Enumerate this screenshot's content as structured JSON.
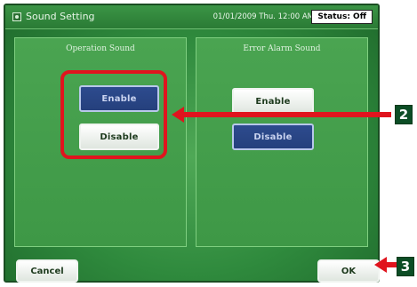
{
  "header": {
    "title": "Sound Setting",
    "datetime": "01/01/2009 Thu. 12:00 AM",
    "status": "Status: Off"
  },
  "panels": {
    "operation": {
      "label": "Operation Sound",
      "enable": "Enable",
      "disable": "Disable",
      "selected": "Enable"
    },
    "error": {
      "label": "Error Alarm Sound",
      "enable": "Enable",
      "disable": "Disable",
      "selected": "Disable"
    }
  },
  "footer": {
    "cancel": "Cancel",
    "ok": "OK"
  },
  "callouts": {
    "step2": "2",
    "step3": "3"
  },
  "colors": {
    "accent_red": "#e0141e",
    "screen_green": "#2f8a3d",
    "selected_blue": "#2d4b8e",
    "callout_green": "#0c4d25"
  }
}
